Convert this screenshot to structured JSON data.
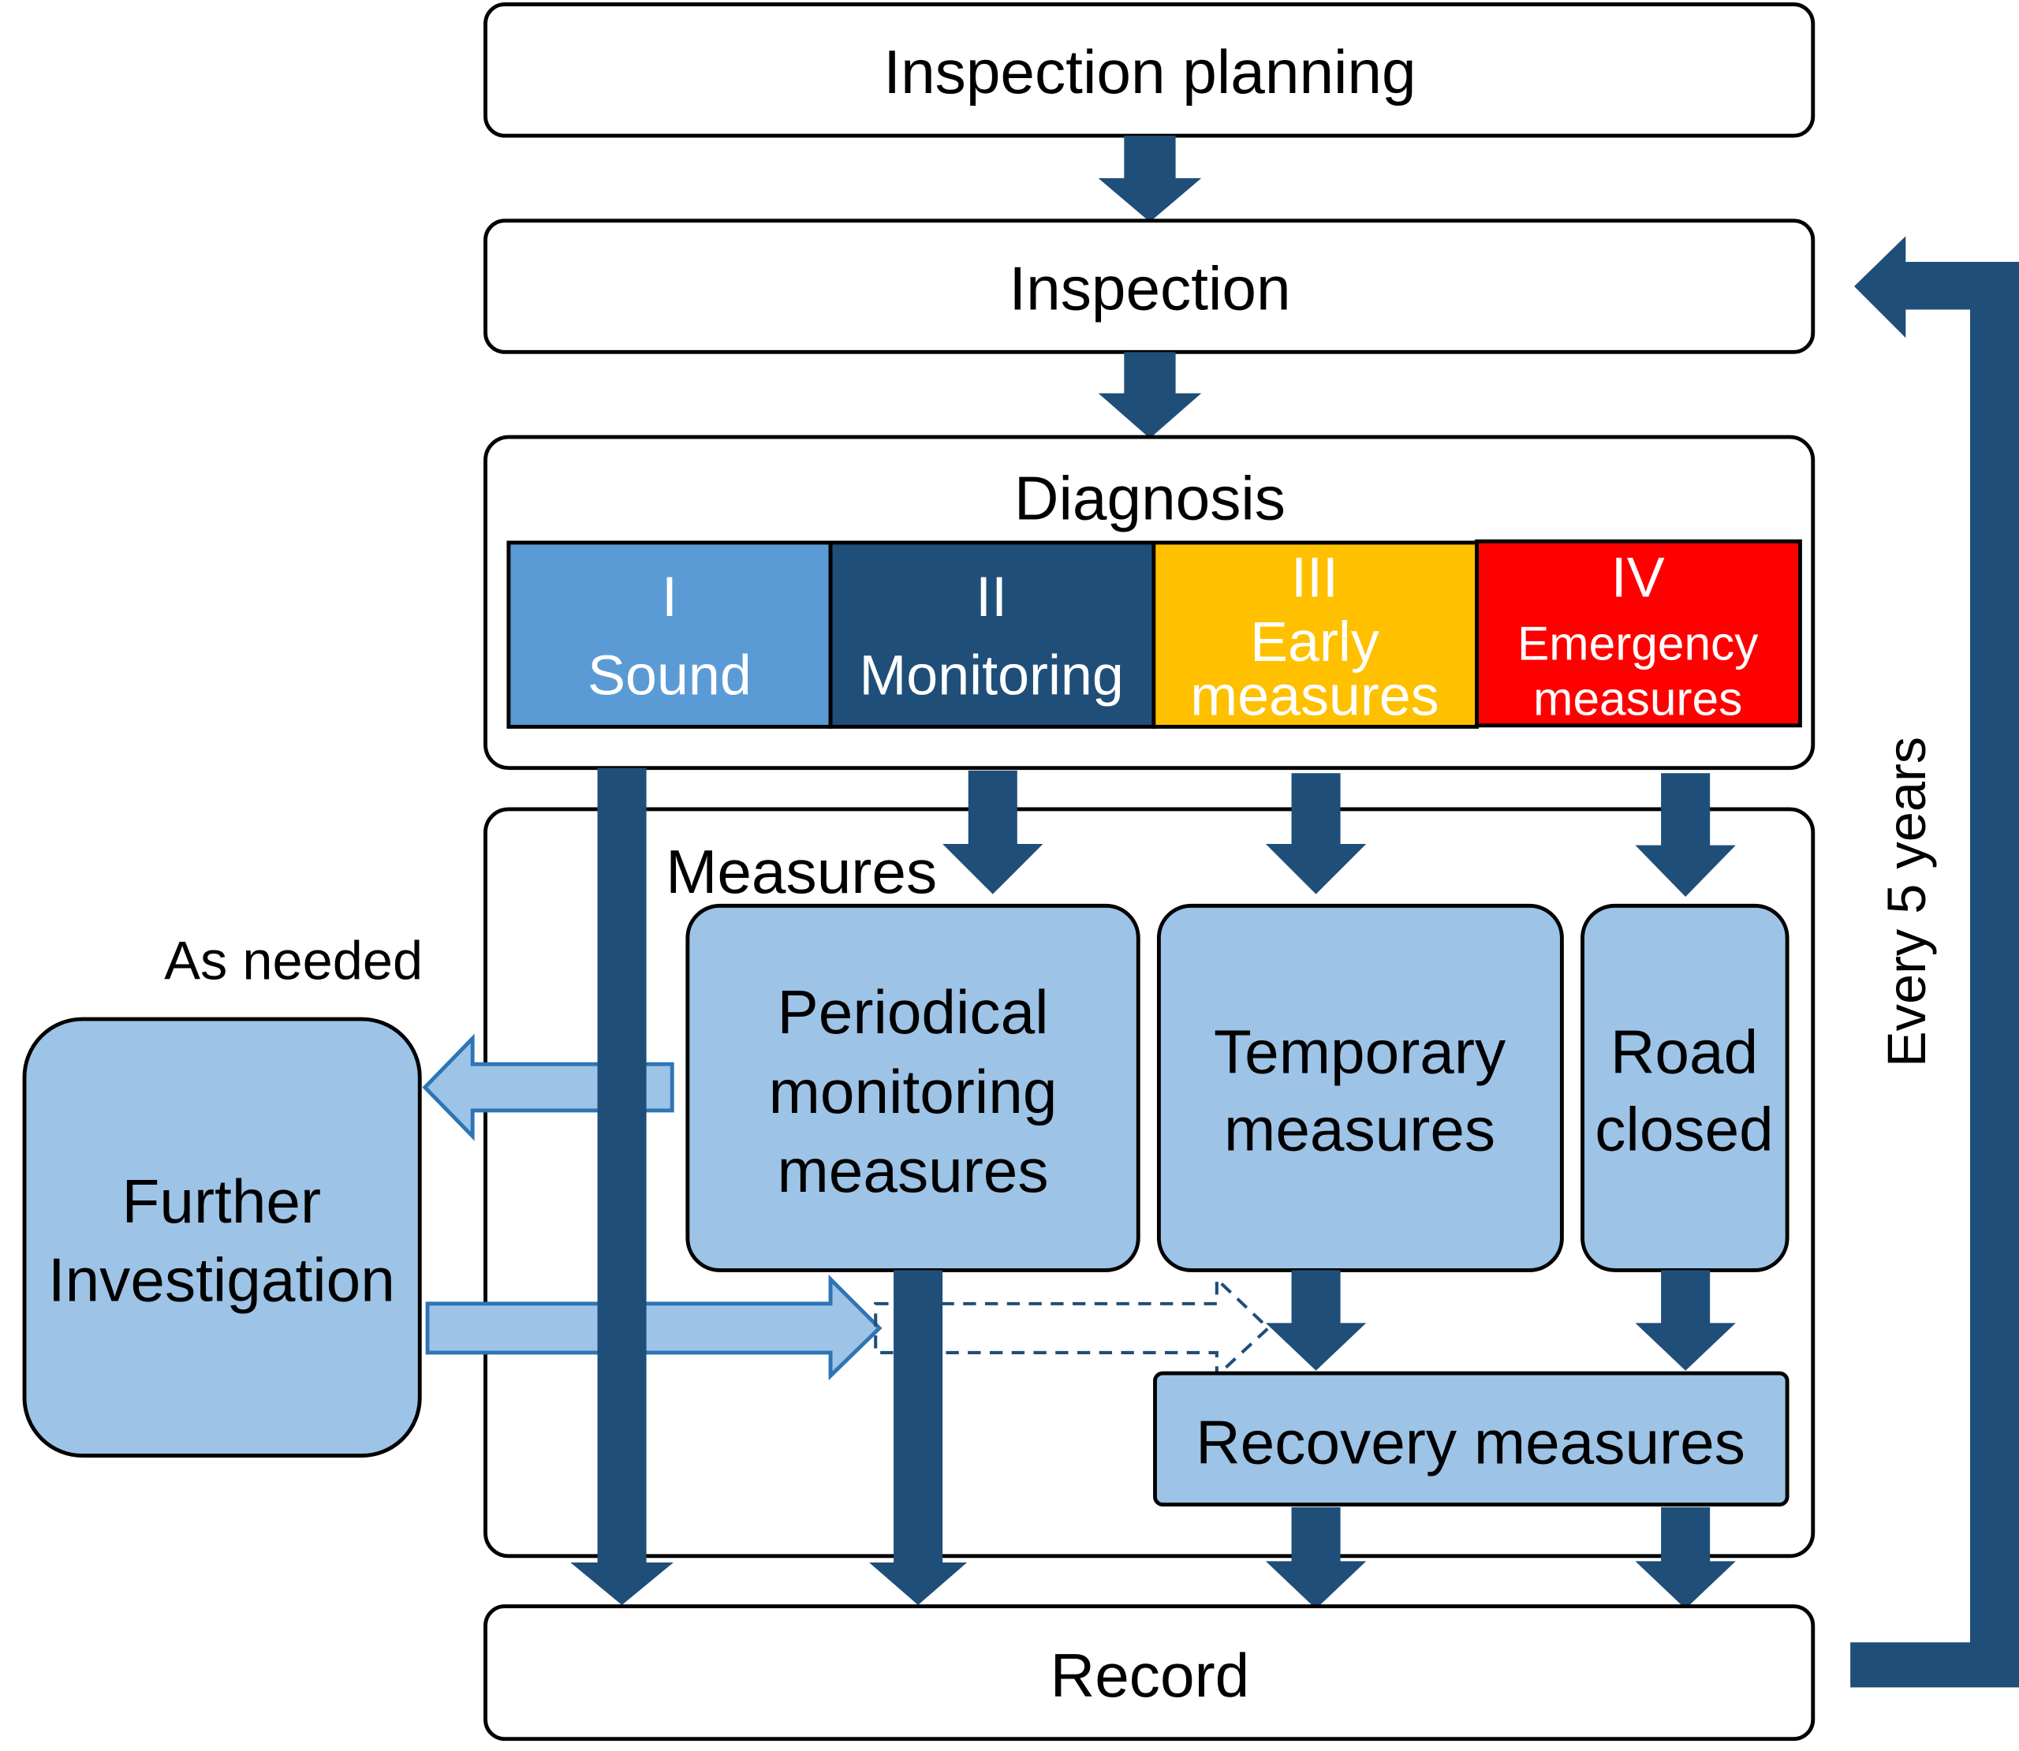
{
  "steps": {
    "planning": "Inspection planning",
    "inspection": "Inspection",
    "diagnosis": "Diagnosis",
    "measures": "Measures",
    "record": "Record"
  },
  "categories": [
    {
      "numeral": "I",
      "label_lines": [
        "Sound"
      ],
      "color": "#5b9bd5"
    },
    {
      "numeral": "II",
      "label_lines": [
        "Monitoring"
      ],
      "color": "#1f4e79"
    },
    {
      "numeral": "III",
      "label_lines": [
        "Early",
        "measures"
      ],
      "color": "#ffc000"
    },
    {
      "numeral": "IV",
      "label_lines": [
        "Emergency",
        "measures"
      ],
      "color": "#ff0000"
    }
  ],
  "measure_boxes": {
    "periodical": [
      "Periodical",
      "monitoring",
      "measures"
    ],
    "temporary": [
      "Temporary",
      "measures"
    ],
    "road_closed": [
      "Road",
      "closed"
    ],
    "recovery": "Recovery measures"
  },
  "further": {
    "lines": [
      "Further",
      "Investigation"
    ],
    "note": "As needed"
  },
  "loop_label": "Every 5 years",
  "colors": {
    "arrow": "#1f4e79",
    "box_fill": "#9dc3e6",
    "hollow_stroke": "#2e75b6"
  }
}
